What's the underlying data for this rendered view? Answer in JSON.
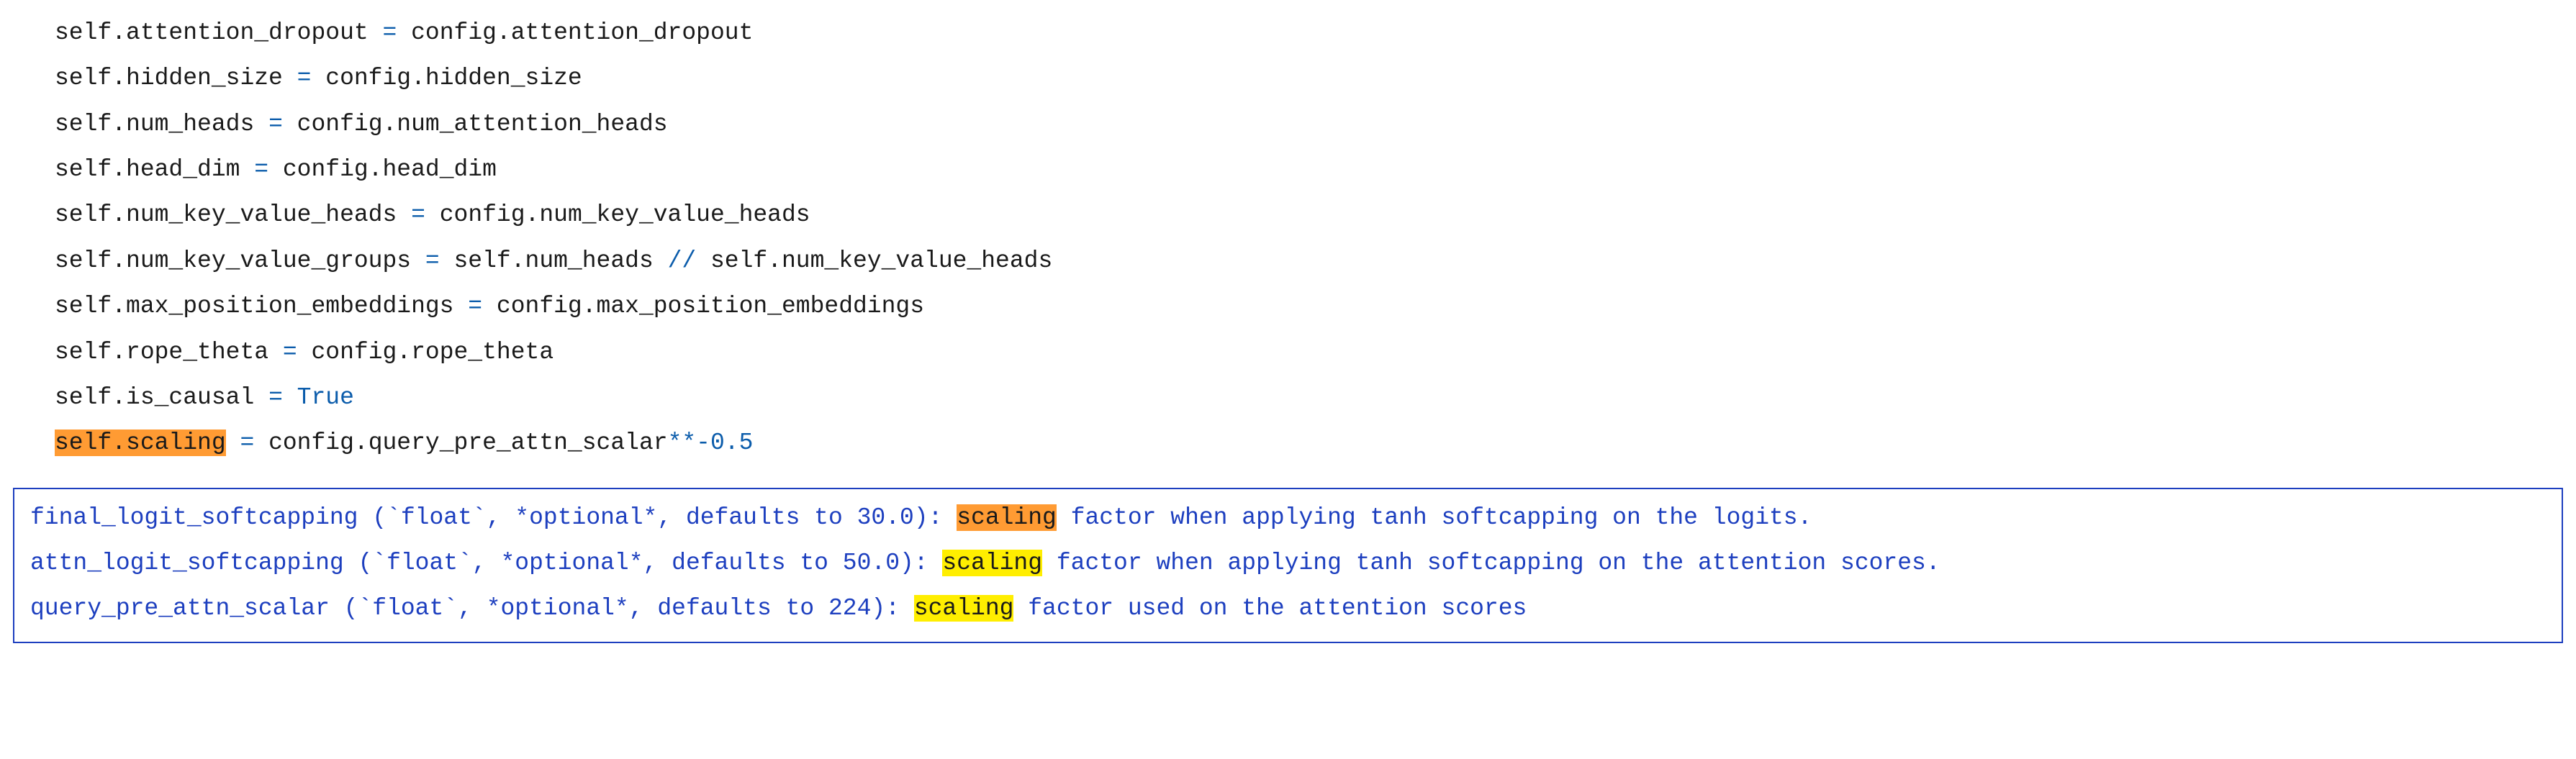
{
  "code": {
    "lines": [
      {
        "pre": "self.attention_dropout ",
        "op": "=",
        "post": " config.attention_dropout"
      },
      {
        "pre": "self.hidden_size ",
        "op": "=",
        "post": " config.hidden_size"
      },
      {
        "pre": "self.num_heads ",
        "op": "=",
        "post": " config.num_attention_heads"
      },
      {
        "pre": "self.head_dim ",
        "op": "=",
        "post": " config.head_dim"
      },
      {
        "pre": "self.num_key_value_heads ",
        "op": "=",
        "post": " config.num_key_value_heads"
      },
      {
        "pre": "self.num_key_value_groups ",
        "op": "=",
        "post_a": " self.num_heads ",
        "op2": "//",
        "post_b": " self.num_key_value_heads"
      },
      {
        "pre": "self.max_position_embeddings ",
        "op": "=",
        "post": " config.max_position_embeddings"
      },
      {
        "pre": "self.rope_theta ",
        "op": "=",
        "post": " config.rope_theta"
      },
      {
        "pre": "self.is_causal ",
        "op": "=",
        "post_true": " True"
      },
      {
        "hl_pre": "self.scaling",
        "sp": " ",
        "op": "=",
        "post_a": " config.query_pre_attn_scalar",
        "op2": "**-",
        "num": "0.5"
      }
    ]
  },
  "doc": {
    "lines": [
      {
        "name": "final_logit_softcapping (`float`, *optional*, defaults to 30.0): ",
        "hl": "scaling",
        "desc": " factor when applying tanh softcapping on the logits.",
        "hl_class": "hl-orange"
      },
      {
        "name": "attn_logit_softcapping (`float`, *optional*, defaults to 50.0): ",
        "hl": "scaling",
        "desc": " factor when applying tanh softcapping on the attention scores.",
        "hl_class": "hl-yellow"
      },
      {
        "name": "query_pre_attn_scalar (`float`, *optional*, defaults to 224): ",
        "hl": "scaling",
        "desc": " factor used on the attention scores",
        "hl_class": "hl-yellow"
      }
    ]
  }
}
